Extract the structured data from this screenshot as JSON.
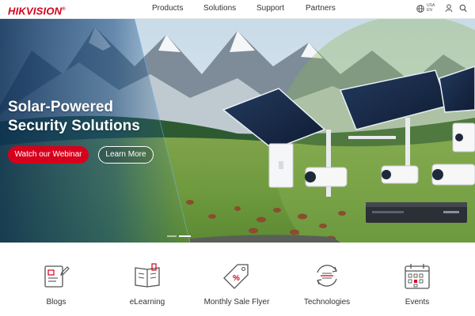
{
  "header": {
    "logo_text": "HIKVISION",
    "logo_mark": "®",
    "nav": {
      "products": "Products",
      "solutions": "Solutions",
      "support": "Support",
      "partners": "Partners"
    },
    "region": {
      "country": "USA",
      "language": "EN"
    },
    "icons": [
      "globe-icon",
      "user-icon",
      "search-icon"
    ]
  },
  "hero": {
    "title_line1": "Solar-Powered",
    "title_line2": "Security Solutions",
    "primary_button": "Watch our Webinar",
    "secondary_button": "Learn More",
    "slide_count": 2,
    "active_slide": 1
  },
  "quick_links": [
    {
      "label": "Blogs",
      "icon": "blog-document-icon"
    },
    {
      "label": "eLearning",
      "icon": "elearning-book-icon"
    },
    {
      "label": "Monthly Sale Flyer",
      "icon": "sale-tag-icon"
    },
    {
      "label": "Technologies",
      "icon": "technology-arrows-icon"
    },
    {
      "label": "Events",
      "icon": "calendar-icon"
    }
  ],
  "colors": {
    "brand_red": "#d6001c",
    "text_dark": "#333333",
    "white": "#ffffff"
  }
}
